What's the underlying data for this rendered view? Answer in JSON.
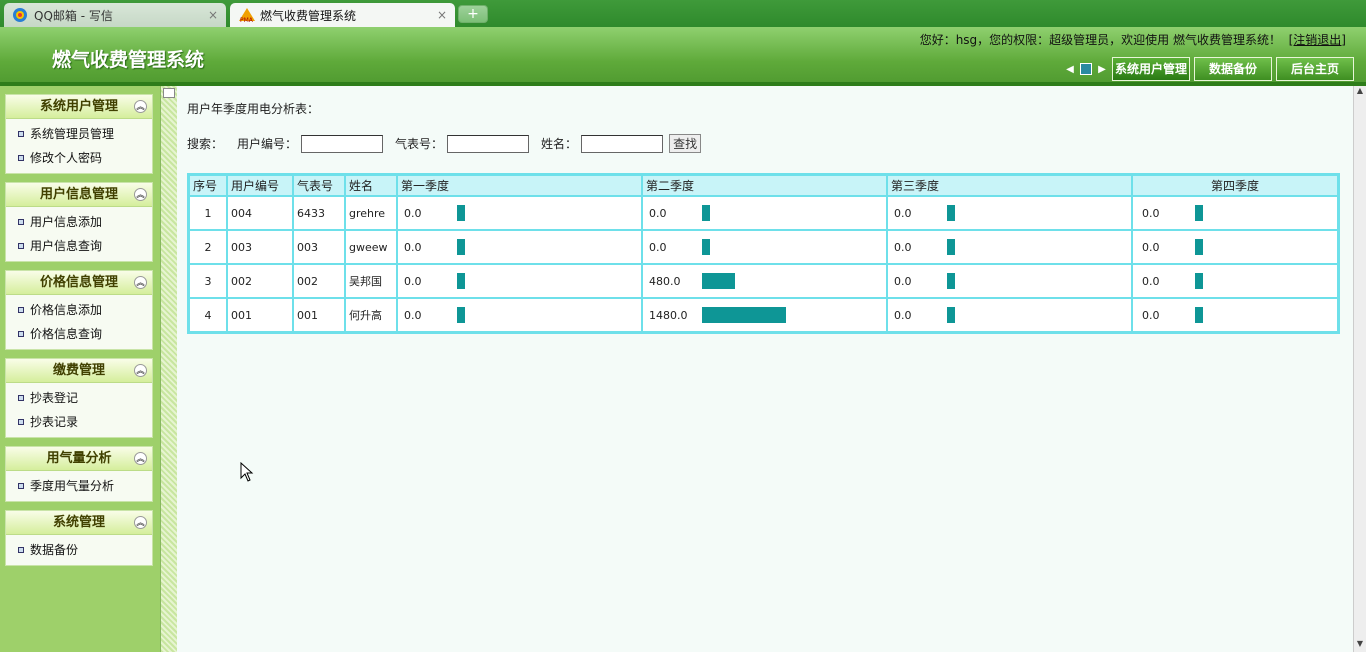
{
  "browser": {
    "tabs": [
      {
        "title": "QQ邮箱 - 写信",
        "icon": "qq-mail-icon"
      },
      {
        "title": "燃气收费管理系统",
        "icon": "pma-icon"
      }
    ],
    "new_tab_label": "+",
    "close_label": "×"
  },
  "header": {
    "logo": "燃气收费管理系统",
    "welcome": "您好：hsg，您的权限：超级管理员，欢迎使用 燃气收费管理系统！",
    "logout": "[注销退出]",
    "nav": [
      "系统用户管理",
      "数据备份",
      "后台主页"
    ]
  },
  "sidebar": [
    {
      "title": "系统用户管理",
      "items": [
        "系统管理员管理",
        "修改个人密码"
      ]
    },
    {
      "title": "用户信息管理",
      "items": [
        "用户信息添加",
        "用户信息查询"
      ]
    },
    {
      "title": "价格信息管理",
      "items": [
        "价格信息添加",
        "价格信息查询"
      ]
    },
    {
      "title": "缴费管理",
      "items": [
        "抄表登记",
        "抄表记录"
      ]
    },
    {
      "title": "用气量分析",
      "items": [
        "季度用气量分析"
      ]
    },
    {
      "title": "系统管理",
      "items": [
        "数据备份"
      ]
    }
  ],
  "main": {
    "title": "用户年季度用电分析表：",
    "search": {
      "label": "搜索：",
      "user_no_label": "用户编号：",
      "meter_label": "气表号：",
      "name_label": "姓名：",
      "button": "查找"
    },
    "table": {
      "headers": [
        "序号",
        "用户编号",
        "气表号",
        "姓名",
        "第一季度",
        "第二季度",
        "第三季度",
        "第四季度"
      ],
      "rows": [
        {
          "idx": "1",
          "user_no": "004",
          "meter": "6433",
          "name": "grehre",
          "q": [
            "0.0",
            "0.0",
            "0.0",
            "0.0"
          ]
        },
        {
          "idx": "2",
          "user_no": "003",
          "meter": "003",
          "name": "gweew",
          "q": [
            "0.0",
            "0.0",
            "0.0",
            "0.0"
          ]
        },
        {
          "idx": "3",
          "user_no": "002",
          "meter": "002",
          "name": "吴邦国",
          "q": [
            "0.0",
            "480.0",
            "0.0",
            "0.0"
          ]
        },
        {
          "idx": "4",
          "user_no": "001",
          "meter": "001",
          "name": "何升高",
          "q": [
            "0.0",
            "1480.0",
            "0.0",
            "0.0"
          ]
        }
      ]
    }
  },
  "colors": {
    "bar": "#0e9696",
    "table_border": "#6ee0ea",
    "header_green": "#5faa3a"
  }
}
